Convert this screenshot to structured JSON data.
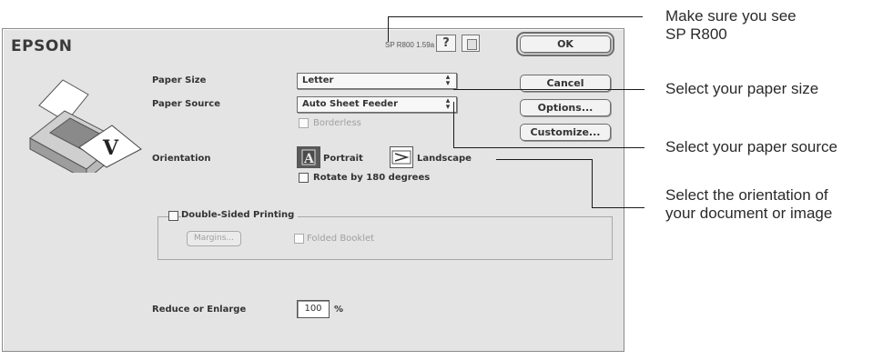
{
  "dialog": {
    "brand": "EPSON",
    "version": "SP R800 1.59a",
    "help_label": "?",
    "buttons": {
      "ok": "OK",
      "cancel": "Cancel",
      "options": "Options...",
      "customize": "Customize..."
    }
  },
  "settings": {
    "paper_size_label": "Paper Size",
    "paper_size_value": "Letter",
    "paper_source_label": "Paper Source",
    "paper_source_value": "Auto Sheet Feeder",
    "borderless_label": "Borderless",
    "orientation_label": "Orientation",
    "portrait_label": "Portrait",
    "landscape_label": "Landscape",
    "rotate_label": "Rotate by 180 degrees",
    "double_sided_label": "Double-Sided Printing",
    "margins_label": "Margins...",
    "folded_booklet_label": "Folded Booklet",
    "reduce_enlarge_label": "Reduce or Enlarge",
    "reduce_enlarge_value": "100",
    "percent_sign": "%"
  },
  "callouts": {
    "version": "Make sure you see\nSP R800",
    "paper_size": "Select your paper size",
    "paper_source": "Select your paper source",
    "orientation": "Select the orientation of\nyour document or image"
  },
  "colors": {
    "dialog_bg": "#e4e4e4",
    "orientation_selected_bg": "#5a5a5a",
    "callout_line": "#1a1a1a"
  },
  "icons": {
    "printer": "printer-illustration",
    "portrait": "portrait-orientation-icon",
    "landscape": "landscape-orientation-icon",
    "help": "help-icon",
    "info": "printer-info-icon"
  }
}
